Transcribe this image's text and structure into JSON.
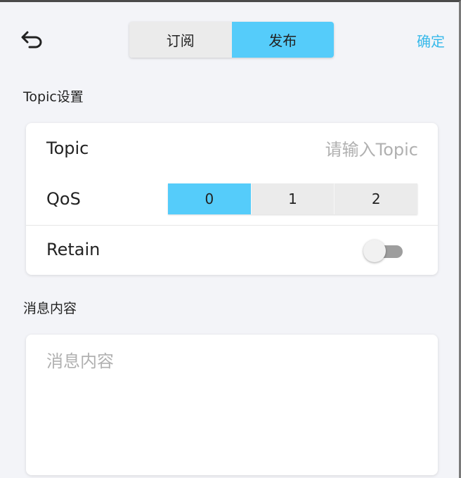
{
  "header": {
    "tabs": [
      {
        "label": "订阅",
        "active": false
      },
      {
        "label": "发布",
        "active": true
      }
    ],
    "confirm_label": "确定"
  },
  "topic_section": {
    "title": "Topic设置",
    "topic_label": "Topic",
    "topic_value": "",
    "topic_placeholder": "请输入Topic",
    "qos_label": "QoS",
    "qos_options": [
      "0",
      "1",
      "2"
    ],
    "qos_selected": "0",
    "retain_label": "Retain",
    "retain_on": false
  },
  "message_section": {
    "title": "消息内容",
    "value": "",
    "placeholder": "消息内容"
  },
  "colors": {
    "accent": "#55ccfa",
    "confirm_text": "#37b9ea",
    "background": "#f3f4f8"
  },
  "icons": {
    "back": "undo-arrow-icon"
  }
}
